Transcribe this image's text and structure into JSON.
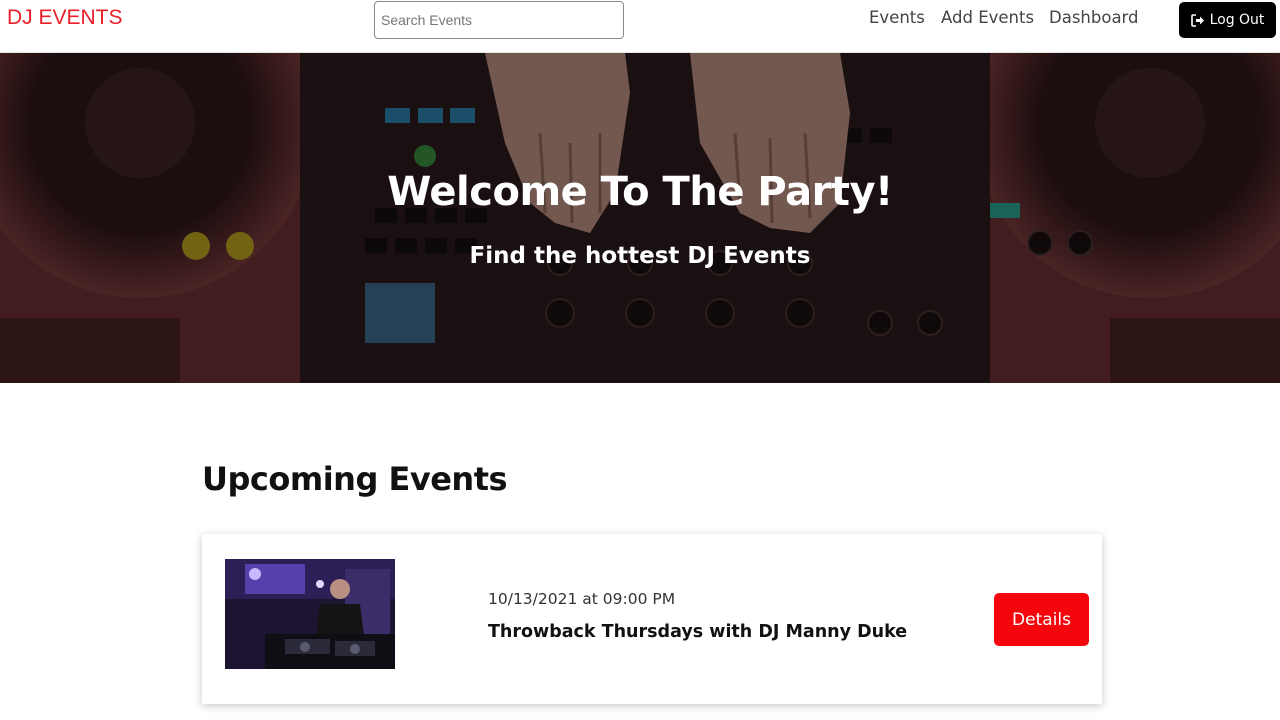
{
  "navbar": {
    "logo": "DJ EVENTS",
    "search_placeholder": "Search Events",
    "links": [
      {
        "label": "Events"
      },
      {
        "label": "Add Events"
      },
      {
        "label": "Dashboard"
      }
    ],
    "logout_label": "Log Out"
  },
  "hero": {
    "title": "Welcome To The Party!",
    "subtitle": "Find the hottest DJ Events"
  },
  "upcoming": {
    "title": "Upcoming Events",
    "events": [
      {
        "date": "10/13/2021 at 09:00 PM",
        "name": "Throwback Thursdays with DJ Manny Duke",
        "details_label": "Details"
      }
    ]
  },
  "colors": {
    "brand_red": "#e8202a",
    "button_red": "#f4060c",
    "logout_bg": "#000000"
  },
  "icons": {
    "logout": "sign-out-icon"
  }
}
